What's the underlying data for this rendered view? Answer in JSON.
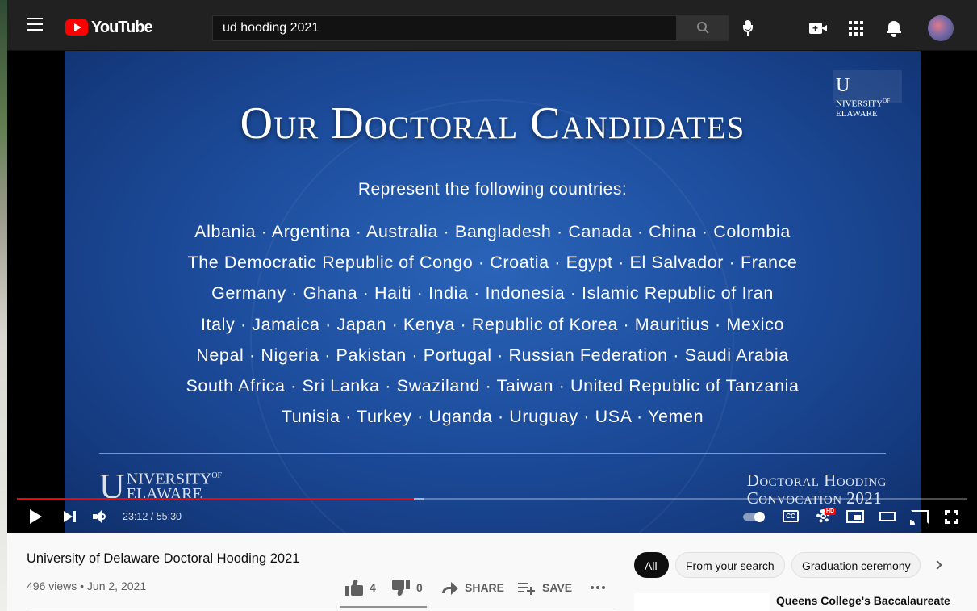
{
  "header": {
    "logo_text": "YouTube",
    "search_value": "ud hooding 2021"
  },
  "slide": {
    "logo_top_line1": "NIVERSITY",
    "logo_top_of": "OF",
    "logo_top_line2": "ELAWARE",
    "title": "Our Doctoral Candidates",
    "subtitle": "Represent the following countries:",
    "countries": [
      "Albania · Argentina · Australia · Bangladesh · Canada · China · Colombia",
      "The Democratic Republic of Congo · Croatia · Egypt · El Salvador · France",
      "Germany · Ghana · Haiti · India · Indonesia · Islamic Republic of Iran",
      "Italy · Jamaica · Japan · Kenya · Republic of Korea · Mauritius · Mexico",
      "Nepal · Nigeria · Pakistan · Portugal · Russian Federation · Saudi Arabia",
      "South Africa · Sri Lanka · Swaziland · Taiwan · United Republic of Tanzania",
      "Tunisia · Turkey · Uganda · Uruguay · USA · Yemen"
    ],
    "logo_bottom_line1": "NIVERSITY",
    "logo_bottom_of": "OF",
    "logo_bottom_line2": "ELAWARE",
    "hooding_line1": "Doctoral Hooding",
    "hooding_line2": "Convocation 2021"
  },
  "player": {
    "time": "23:12 / 55:30",
    "played_fraction": 0.418,
    "loaded_fraction": 0.428,
    "hd_badge": "HD",
    "progress_color": "#ff0000"
  },
  "video": {
    "title": "University of Delaware Doctoral Hooding 2021",
    "meta": "496 views • Jun 2, 2021",
    "likes": "4",
    "dislikes": "0",
    "share_label": "SHARE",
    "save_label": "SAVE"
  },
  "chips": {
    "all": "All",
    "from_search": "From your search",
    "graduation": "Graduation ceremony"
  },
  "recommendation": {
    "title": "Queens College's Baccalaureate Convocation"
  }
}
